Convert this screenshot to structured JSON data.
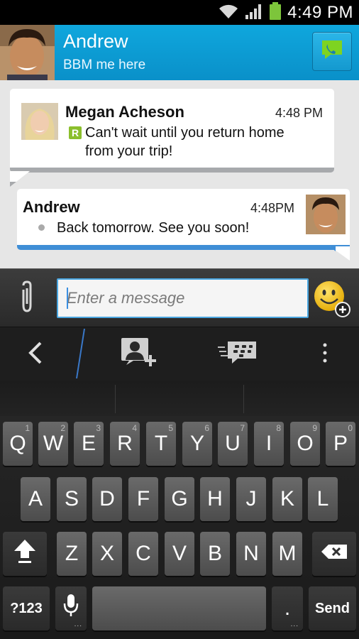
{
  "status_bar": {
    "time": "4:49 PM"
  },
  "header": {
    "contact_name": "Andrew",
    "contact_status": "BBM me here"
  },
  "messages": [
    {
      "sender": "Megan Acheson",
      "time": "4:48 PM",
      "status_badge": "R",
      "text_line1": "Can't wait until you return home",
      "text_line2": "from your trip!"
    },
    {
      "sender": "Andrew",
      "time": "4:48PM",
      "text": "Back tomorrow. See you soon!"
    }
  ],
  "composer": {
    "placeholder": "Enter a message"
  },
  "keyboard": {
    "row1": [
      {
        "label": "Q",
        "sup": "1"
      },
      {
        "label": "W",
        "sup": "2"
      },
      {
        "label": "E",
        "sup": "3"
      },
      {
        "label": "R",
        "sup": "4"
      },
      {
        "label": "T",
        "sup": "5"
      },
      {
        "label": "Y",
        "sup": "6"
      },
      {
        "label": "U",
        "sup": "7"
      },
      {
        "label": "I",
        "sup": "8"
      },
      {
        "label": "O",
        "sup": "9"
      },
      {
        "label": "P",
        "sup": "0"
      }
    ],
    "row2": [
      "A",
      "S",
      "D",
      "F",
      "G",
      "H",
      "J",
      "K",
      "L"
    ],
    "row3": [
      "Z",
      "X",
      "C",
      "V",
      "B",
      "N",
      "M"
    ],
    "symbols_label": "?123",
    "period_label": ".",
    "send_label": "Send"
  }
}
